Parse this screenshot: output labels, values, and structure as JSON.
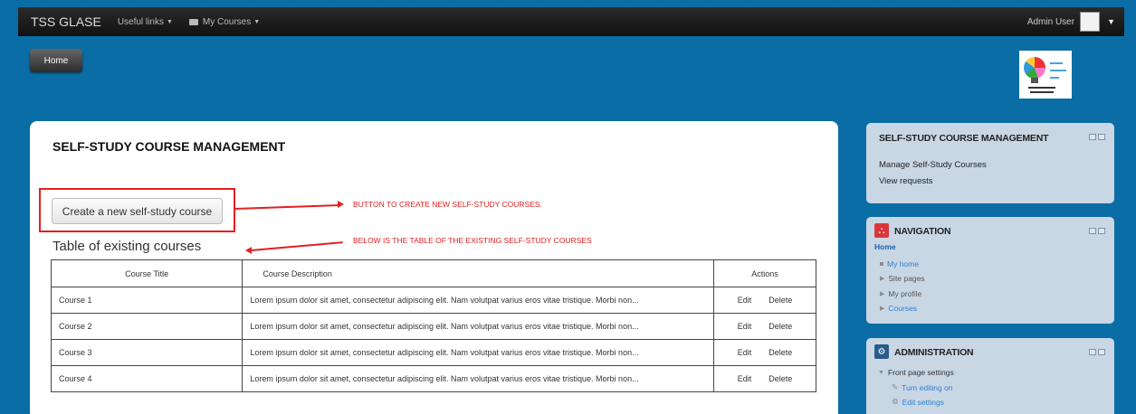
{
  "navbar": {
    "brand": "TSS GLASE",
    "useful_links": "Useful links",
    "my_courses": "My Courses",
    "user_name": "Admin User"
  },
  "home_button": "Home",
  "main": {
    "title": "SELF-STUDY COURSE MANAGEMENT",
    "create_button": "Create a new self-study course",
    "table_title": "Table of existing courses",
    "annotation_button": "BUTTON TO CREATE NEW SELF-STUDY COURSES.",
    "annotation_table": "BELOW IS THE TABLE OF THE EXISTING SELF-STUDY COURSES",
    "columns": [
      "Course Title",
      "Course Description",
      "Actions"
    ],
    "rows": [
      {
        "title": "Course 1",
        "description": "Lorem ipsum dolor sit amet, consectetur adipiscing elit. Nam volutpat varius eros vitae tristique. Morbi non...",
        "edit": "Edit",
        "delete": "Delete"
      },
      {
        "title": "Course 2",
        "description": "Lorem ipsum dolor sit amet, consectetur adipiscing elit. Nam volutpat varius eros vitae tristique. Morbi non...",
        "edit": "Edit",
        "delete": "Delete"
      },
      {
        "title": "Course 3",
        "description": "Lorem ipsum dolor sit amet, consectetur adipiscing elit. Nam volutpat varius eros vitae tristique. Morbi non...",
        "edit": "Edit",
        "delete": "Delete"
      },
      {
        "title": "Course 4",
        "description": "Lorem ipsum dolor sit amet, consectetur adipiscing elit. Nam volutpat varius eros vitae tristique. Morbi non...",
        "edit": "Edit",
        "delete": "Delete"
      }
    ]
  },
  "sidebar": {
    "management": {
      "title": "SELF-STUDY COURSE MANAGEMENT",
      "links": [
        "Manage Self-Study Courses",
        "View requests"
      ]
    },
    "navigation": {
      "title": "NAVIGATION",
      "home": "Home",
      "items": [
        "My home",
        "Site pages",
        "My profile",
        "Courses"
      ]
    },
    "administration": {
      "title": "ADMINISTRATION",
      "items": [
        "Front page settings",
        "Turn editing on",
        "Edit settings"
      ]
    }
  },
  "colors": {
    "background": "#0a6da6",
    "annotation": "#e32020",
    "block": "#c9d7e5",
    "link": "#2f7fcf"
  }
}
